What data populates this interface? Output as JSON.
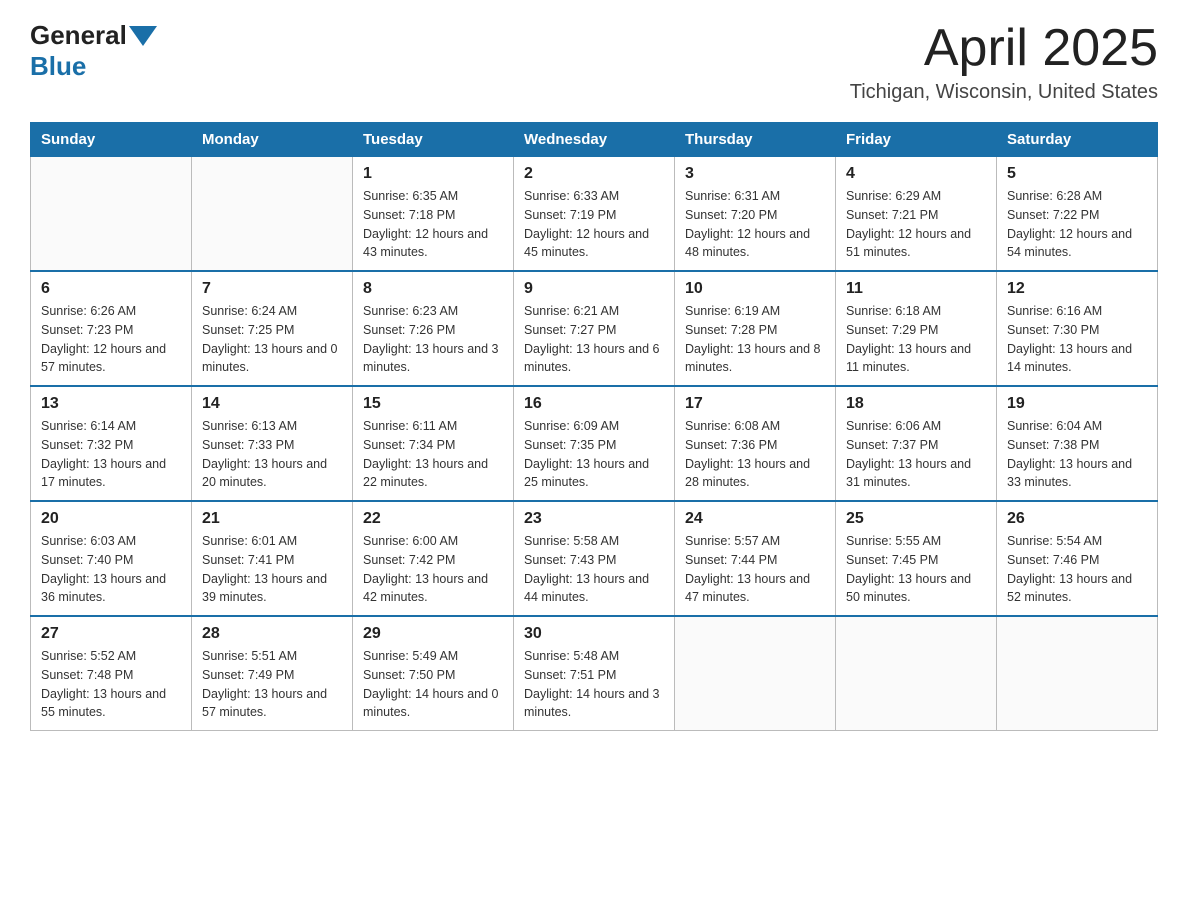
{
  "header": {
    "logo_general": "General",
    "logo_blue": "Blue",
    "month_title": "April 2025",
    "location": "Tichigan, Wisconsin, United States"
  },
  "weekdays": [
    "Sunday",
    "Monday",
    "Tuesday",
    "Wednesday",
    "Thursday",
    "Friday",
    "Saturday"
  ],
  "weeks": [
    [
      {
        "day": "",
        "sunrise": "",
        "sunset": "",
        "daylight": ""
      },
      {
        "day": "",
        "sunrise": "",
        "sunset": "",
        "daylight": ""
      },
      {
        "day": "1",
        "sunrise": "Sunrise: 6:35 AM",
        "sunset": "Sunset: 7:18 PM",
        "daylight": "Daylight: 12 hours and 43 minutes."
      },
      {
        "day": "2",
        "sunrise": "Sunrise: 6:33 AM",
        "sunset": "Sunset: 7:19 PM",
        "daylight": "Daylight: 12 hours and 45 minutes."
      },
      {
        "day": "3",
        "sunrise": "Sunrise: 6:31 AM",
        "sunset": "Sunset: 7:20 PM",
        "daylight": "Daylight: 12 hours and 48 minutes."
      },
      {
        "day": "4",
        "sunrise": "Sunrise: 6:29 AM",
        "sunset": "Sunset: 7:21 PM",
        "daylight": "Daylight: 12 hours and 51 minutes."
      },
      {
        "day": "5",
        "sunrise": "Sunrise: 6:28 AM",
        "sunset": "Sunset: 7:22 PM",
        "daylight": "Daylight: 12 hours and 54 minutes."
      }
    ],
    [
      {
        "day": "6",
        "sunrise": "Sunrise: 6:26 AM",
        "sunset": "Sunset: 7:23 PM",
        "daylight": "Daylight: 12 hours and 57 minutes."
      },
      {
        "day": "7",
        "sunrise": "Sunrise: 6:24 AM",
        "sunset": "Sunset: 7:25 PM",
        "daylight": "Daylight: 13 hours and 0 minutes."
      },
      {
        "day": "8",
        "sunrise": "Sunrise: 6:23 AM",
        "sunset": "Sunset: 7:26 PM",
        "daylight": "Daylight: 13 hours and 3 minutes."
      },
      {
        "day": "9",
        "sunrise": "Sunrise: 6:21 AM",
        "sunset": "Sunset: 7:27 PM",
        "daylight": "Daylight: 13 hours and 6 minutes."
      },
      {
        "day": "10",
        "sunrise": "Sunrise: 6:19 AM",
        "sunset": "Sunset: 7:28 PM",
        "daylight": "Daylight: 13 hours and 8 minutes."
      },
      {
        "day": "11",
        "sunrise": "Sunrise: 6:18 AM",
        "sunset": "Sunset: 7:29 PM",
        "daylight": "Daylight: 13 hours and 11 minutes."
      },
      {
        "day": "12",
        "sunrise": "Sunrise: 6:16 AM",
        "sunset": "Sunset: 7:30 PM",
        "daylight": "Daylight: 13 hours and 14 minutes."
      }
    ],
    [
      {
        "day": "13",
        "sunrise": "Sunrise: 6:14 AM",
        "sunset": "Sunset: 7:32 PM",
        "daylight": "Daylight: 13 hours and 17 minutes."
      },
      {
        "day": "14",
        "sunrise": "Sunrise: 6:13 AM",
        "sunset": "Sunset: 7:33 PM",
        "daylight": "Daylight: 13 hours and 20 minutes."
      },
      {
        "day": "15",
        "sunrise": "Sunrise: 6:11 AM",
        "sunset": "Sunset: 7:34 PM",
        "daylight": "Daylight: 13 hours and 22 minutes."
      },
      {
        "day": "16",
        "sunrise": "Sunrise: 6:09 AM",
        "sunset": "Sunset: 7:35 PM",
        "daylight": "Daylight: 13 hours and 25 minutes."
      },
      {
        "day": "17",
        "sunrise": "Sunrise: 6:08 AM",
        "sunset": "Sunset: 7:36 PM",
        "daylight": "Daylight: 13 hours and 28 minutes."
      },
      {
        "day": "18",
        "sunrise": "Sunrise: 6:06 AM",
        "sunset": "Sunset: 7:37 PM",
        "daylight": "Daylight: 13 hours and 31 minutes."
      },
      {
        "day": "19",
        "sunrise": "Sunrise: 6:04 AM",
        "sunset": "Sunset: 7:38 PM",
        "daylight": "Daylight: 13 hours and 33 minutes."
      }
    ],
    [
      {
        "day": "20",
        "sunrise": "Sunrise: 6:03 AM",
        "sunset": "Sunset: 7:40 PM",
        "daylight": "Daylight: 13 hours and 36 minutes."
      },
      {
        "day": "21",
        "sunrise": "Sunrise: 6:01 AM",
        "sunset": "Sunset: 7:41 PM",
        "daylight": "Daylight: 13 hours and 39 minutes."
      },
      {
        "day": "22",
        "sunrise": "Sunrise: 6:00 AM",
        "sunset": "Sunset: 7:42 PM",
        "daylight": "Daylight: 13 hours and 42 minutes."
      },
      {
        "day": "23",
        "sunrise": "Sunrise: 5:58 AM",
        "sunset": "Sunset: 7:43 PM",
        "daylight": "Daylight: 13 hours and 44 minutes."
      },
      {
        "day": "24",
        "sunrise": "Sunrise: 5:57 AM",
        "sunset": "Sunset: 7:44 PM",
        "daylight": "Daylight: 13 hours and 47 minutes."
      },
      {
        "day": "25",
        "sunrise": "Sunrise: 5:55 AM",
        "sunset": "Sunset: 7:45 PM",
        "daylight": "Daylight: 13 hours and 50 minutes."
      },
      {
        "day": "26",
        "sunrise": "Sunrise: 5:54 AM",
        "sunset": "Sunset: 7:46 PM",
        "daylight": "Daylight: 13 hours and 52 minutes."
      }
    ],
    [
      {
        "day": "27",
        "sunrise": "Sunrise: 5:52 AM",
        "sunset": "Sunset: 7:48 PM",
        "daylight": "Daylight: 13 hours and 55 minutes."
      },
      {
        "day": "28",
        "sunrise": "Sunrise: 5:51 AM",
        "sunset": "Sunset: 7:49 PM",
        "daylight": "Daylight: 13 hours and 57 minutes."
      },
      {
        "day": "29",
        "sunrise": "Sunrise: 5:49 AM",
        "sunset": "Sunset: 7:50 PM",
        "daylight": "Daylight: 14 hours and 0 minutes."
      },
      {
        "day": "30",
        "sunrise": "Sunrise: 5:48 AM",
        "sunset": "Sunset: 7:51 PM",
        "daylight": "Daylight: 14 hours and 3 minutes."
      },
      {
        "day": "",
        "sunrise": "",
        "sunset": "",
        "daylight": ""
      },
      {
        "day": "",
        "sunrise": "",
        "sunset": "",
        "daylight": ""
      },
      {
        "day": "",
        "sunrise": "",
        "sunset": "",
        "daylight": ""
      }
    ]
  ]
}
